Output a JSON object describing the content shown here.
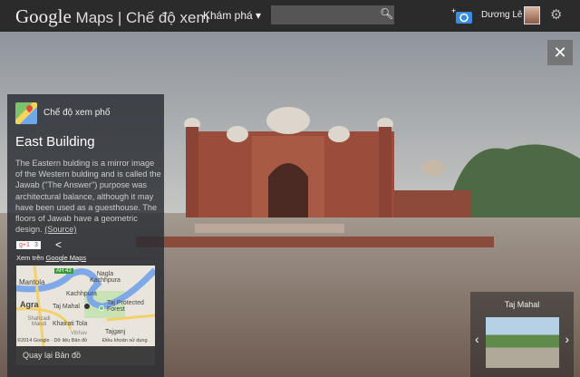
{
  "header": {
    "logo_google": "Google",
    "logo_rest": " Maps | Chế độ xem",
    "explore": "Khám phá ▾",
    "search_placeholder": "",
    "user_name": "Dương Lê"
  },
  "panel": {
    "mode_label": "Chế độ xem phố",
    "title": "East Building",
    "description": "The Eastern bulding is a mirror image of the Western bulding and is called the Jawab (\"The Answer\") purpose was architectural balance, although it may have been used as a guesthouse. The floors of Jawab have a geometric design. ",
    "source_link": "(Source)",
    "gplus": "g+1",
    "gplus_count": "3",
    "view_on_prefix": "Xem trên ",
    "view_on_link": "Google Maps",
    "map": {
      "labels": [
        "AH 43",
        "Mantola",
        "Nagla Kachhpura",
        "Kachhpura",
        "Agra",
        "Taj Mahal",
        "Taj Protected Forest",
        "Shahzadi Mandi",
        "Khairati Tola",
        "Vibhav",
        "Tajganj"
      ],
      "attribution": "©2014 Google · Dữ liệu Bản đồ",
      "terms": "Điều khoản sử dụng"
    },
    "back_to_map": "Quay lại Bản đồ"
  },
  "thumbnail": {
    "title": "Taj Mahal"
  },
  "close_label": "✕"
}
